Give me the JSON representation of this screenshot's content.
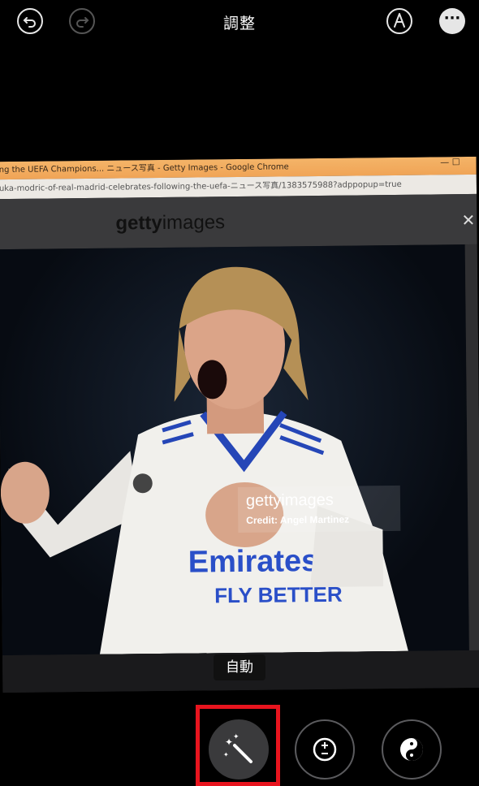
{
  "header": {
    "title": "調整",
    "undo_icon": "undo-icon",
    "redo_icon": "redo-icon",
    "markup_icon": "markup-pen-icon",
    "more_icon": "more-ellipsis-icon"
  },
  "photo": {
    "window_title": "ng the UEFA Champions... ニュース写真 - Getty Images - Google Chrome",
    "window_controls": "— ☐",
    "url": "uka-modric-of-real-madrid-celebrates-following-the-uefa-ニュース写真/1383575988?adppopup=true",
    "logo_bold": "getty",
    "logo_light": "images",
    "close": "✕",
    "watermark_logo": "gettyimages",
    "watermark_credit": "Credit: Angel Martinez",
    "shirt_sponsor_1": "Emirates",
    "shirt_sponsor_2": "FLY BETTER"
  },
  "adjust": {
    "current_tool_label": "自動",
    "tools": [
      {
        "name": "auto",
        "icon": "magic-wand-icon",
        "selected": true
      },
      {
        "name": "exposure",
        "icon": "exposure-plus-minus-icon",
        "selected": false
      },
      {
        "name": "brilliance",
        "icon": "yin-yang-icon",
        "selected": false
      }
    ]
  },
  "colors": {
    "background": "#000000",
    "highlight": "#e8141e",
    "selected_tool": "#3a3a3c"
  }
}
